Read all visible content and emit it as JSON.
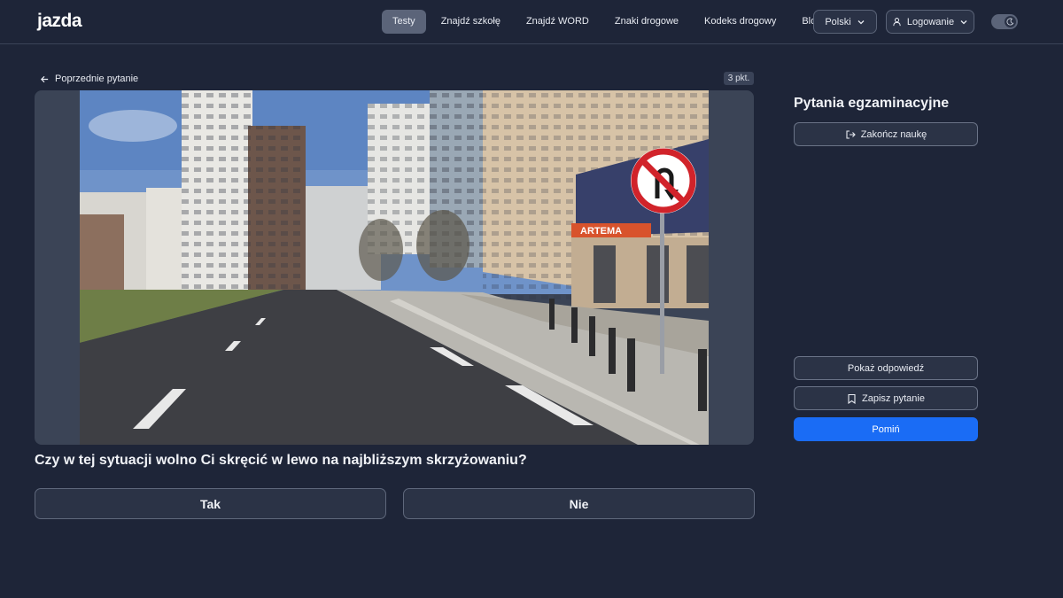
{
  "header": {
    "logo_text": "jazda",
    "nav": [
      {
        "label": "Testy",
        "active": true
      },
      {
        "label": "Znajdź szkołę",
        "active": false
      },
      {
        "label": "Znajdź WORD",
        "active": false
      },
      {
        "label": "Znaki drogowe",
        "active": false
      },
      {
        "label": "Kodeks drogowy",
        "active": false
      },
      {
        "label": "Blog",
        "active": false
      }
    ],
    "language_label": "Polski",
    "login_label": "Logowanie",
    "theme_toggle_icon": "moon-icon"
  },
  "main": {
    "back_label": "Poprzednie pytanie",
    "points_badge": "3 pkt.",
    "question_text": "Czy w tej sytuacji wolno Ci skręcić w lewo na najbliższym skrzyżowaniu?",
    "answers": [
      {
        "label": "Tak"
      },
      {
        "label": "Nie"
      }
    ],
    "image_sign_text": "ARTEMA"
  },
  "side": {
    "title": "Pytania egzaminacyjne",
    "end_label": "Zakończ naukę",
    "show_answer_label": "Pokaż odpowiedź",
    "save_label": "Zapisz pytanie",
    "skip_label": "Pomiń"
  },
  "colors": {
    "background": "#1e2538",
    "primary": "#1a6cf5",
    "nav_active": "#5b6479"
  }
}
